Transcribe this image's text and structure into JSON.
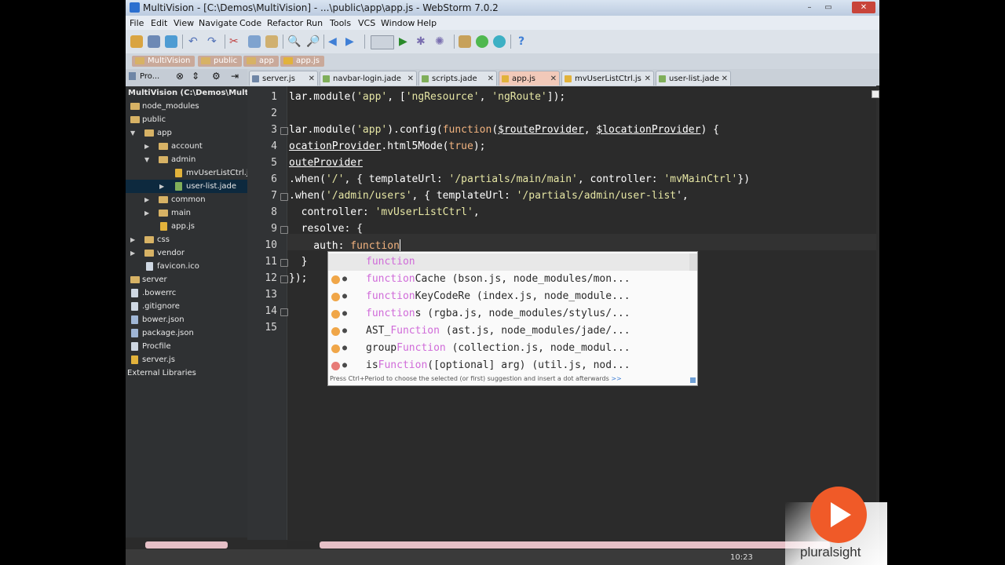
{
  "window": {
    "title": "MultiVision - [C:\\Demos\\MultiVision] - ...\\public\\app\\app.js - WebStorm 7.0.2",
    "controls": [
      "–",
      "▭",
      "✕"
    ]
  },
  "menu": [
    "File",
    "Edit",
    "View",
    "Navigate",
    "Code",
    "Refactor",
    "Run",
    "Tools",
    "VCS",
    "Window",
    "Help"
  ],
  "breadcrumbs": [
    "MultiVision",
    "public",
    "app",
    "app.js"
  ],
  "project_panel": {
    "label": "Pro...",
    "root": "MultiVision (C:\\Demos\\MultiVisio"
  },
  "tabs": [
    {
      "label": "server.js",
      "active": false
    },
    {
      "label": "navbar-login.jade",
      "active": false
    },
    {
      "label": "scripts.jade",
      "active": false
    },
    {
      "label": "app.js",
      "active": true
    },
    {
      "label": "mvUserListCtrl.js",
      "active": false
    },
    {
      "label": "user-list.jade",
      "active": false
    }
  ],
  "tree": [
    {
      "label": "node_modules"
    },
    {
      "label": "public"
    },
    {
      "label": "app"
    },
    {
      "label": "account"
    },
    {
      "label": "admin"
    },
    {
      "label": "mvUserListCtrl.js"
    },
    {
      "label": "user-list.jade"
    },
    {
      "label": "common"
    },
    {
      "label": "main"
    },
    {
      "label": "app.js"
    },
    {
      "label": "css"
    },
    {
      "label": "vendor"
    },
    {
      "label": "favicon.ico"
    },
    {
      "label": "server"
    },
    {
      "label": ".bowerrc"
    },
    {
      "label": ".gitignore"
    },
    {
      "label": "bower.json"
    },
    {
      "label": "package.json"
    },
    {
      "label": "Procfile"
    },
    {
      "label": "server.js"
    },
    {
      "label": "External Libraries"
    }
  ],
  "line_numbers": [
    "1",
    "2",
    "3",
    "4",
    "5",
    "6",
    "7",
    "8",
    "9",
    "10",
    "11",
    "12",
    "13",
    "14",
    "15"
  ],
  "code": {
    "l1": "lar.module(",
    "l1_s1": "'app'",
    "l1_b": ", [",
    "l1_s2": "'ngResource'",
    "l1_c": ", ",
    "l1_s3": "'ngRoute'",
    "l1_d": "]);",
    "l3_a": "lar.module(",
    "l3_s": "'app'",
    "l3_b": ").config(",
    "l3_kw": "function",
    "l3_c": "(",
    "l3_p1": "$routeProvider",
    "l3_d": ", ",
    "l3_p2": "$locationProvider",
    "l3_e": ") {",
    "l4_u": "ocationProvider",
    "l4_a": ".html5Mode(",
    "l4_kw": "true",
    "l4_b": ");",
    "l5_u": "outeProvider",
    "l6_a": ".when(",
    "l6_s1": "'/'",
    "l6_b": ", { templateUrl: ",
    "l6_s2": "'/partials/main/main'",
    "l6_c": ", controller: ",
    "l6_s3": "'mvMainCtrl'",
    "l6_d": "})",
    "l7_a": ".when(",
    "l7_s1": "'/admin/users'",
    "l7_b": ", { templateUrl: ",
    "l7_s2": "'/partials/admin/user-list",
    "l7_c": "',",
    "l8_a": "  controller: ",
    "l8_s": "'mvUserListCtrl'",
    "l8_b": ",",
    "l9": "  resolve: {",
    "l10_a": "    auth: ",
    "l10_kw": "function",
    "l11": "  }",
    "l12": "});"
  },
  "completion": {
    "items": [
      {
        "pre": "",
        "hl": "function",
        "post": "",
        "dot": "none"
      },
      {
        "pre": "",
        "hl": "function",
        "post": "Cache  (bson.js, node_modules/mon...",
        "dot": "orange"
      },
      {
        "pre": "",
        "hl": "function",
        "post": "KeyCodeRe  (index.js, node_module...",
        "dot": "orange"
      },
      {
        "pre": "",
        "hl": "function",
        "post": "s  (rgba.js, node_modules/stylus/...",
        "dot": "orange"
      },
      {
        "pre": "AST_",
        "hl": "Function",
        "post": "  (ast.js, node_modules/jade/...",
        "dot": "orange"
      },
      {
        "pre": "group",
        "hl": "Function",
        "post": "  (collection.js, node_modul...",
        "dot": "orange"
      },
      {
        "pre": "is",
        "hl": "Function",
        "post": "([optional] arg)  (util.js, nod...",
        "dot": "red"
      }
    ],
    "hint": "Press Ctrl+Period to choose the selected (or first) suggestion and insert a dot afterwards",
    "hint_link": ">>"
  },
  "status": {
    "clock": "10:23"
  },
  "watermark": {
    "brand": "pluralsight"
  }
}
